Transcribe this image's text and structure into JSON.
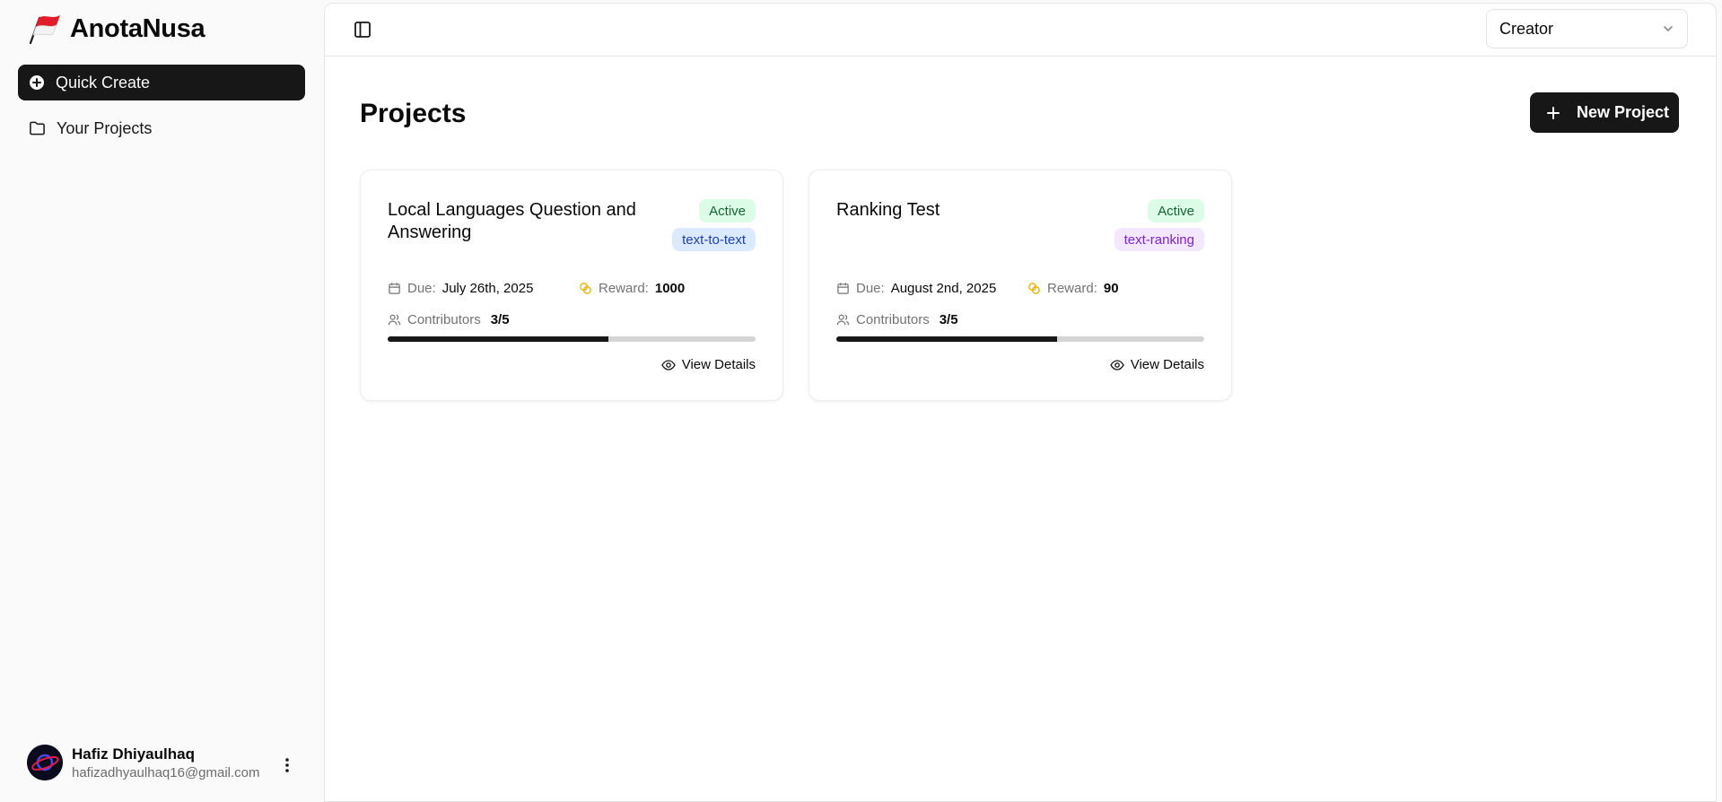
{
  "app": {
    "name": "AnotaNusa"
  },
  "sidebar": {
    "items": [
      {
        "label": "Quick Create"
      },
      {
        "label": "Your Projects"
      }
    ]
  },
  "user": {
    "name": "Hafiz Dhiyaulhaq",
    "email": "hafizadhyaulhaq16@gmail.com"
  },
  "topbar": {
    "role": "Creator"
  },
  "page": {
    "title": "Projects",
    "new_button": "New Project"
  },
  "labels": {
    "due": "Due:",
    "reward": "Reward:",
    "contributors": "Contributors",
    "view": "View Details"
  },
  "projects": [
    {
      "title": "Local Languages Question and Answering",
      "status": "Active",
      "type": "text-to-text",
      "due": "July 26th, 2025",
      "reward": "1000",
      "contributors": "3/5",
      "progress": 0.6
    },
    {
      "title": "Ranking Test",
      "status": "Active",
      "type": "text-ranking",
      "due": "August 2nd, 2025",
      "reward": "90",
      "contributors": "3/5",
      "progress": 0.6
    }
  ],
  "colors": {
    "accent": "#171717",
    "active_bg": "#dcfce7",
    "coin": "#eab308"
  }
}
